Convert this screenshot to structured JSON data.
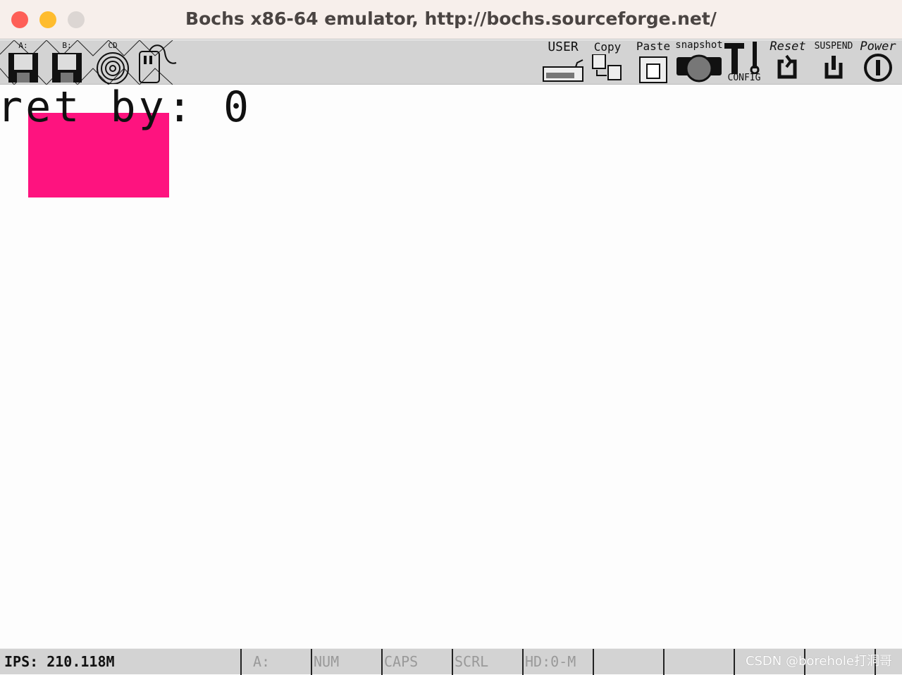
{
  "window": {
    "title": "Bochs x86-64 emulator, http://bochs.sourceforge.net/"
  },
  "toolbar": {
    "floppy_a": "A:",
    "floppy_b": "B:",
    "cdrom": "CD",
    "user": "USER",
    "copy": "Copy",
    "paste": "Paste",
    "snapshot": "snapshot",
    "config": "CONFIG",
    "reset": "Reset",
    "suspend": "SUSPEND",
    "power": "Power"
  },
  "screen": {
    "text": "ret by: 0",
    "rect_color": "#fe137f"
  },
  "statusbar": {
    "ips": "IPS: 210.118M",
    "cells": [
      "A:",
      "NUM",
      "CAPS",
      "SCRL",
      "HD:0-M",
      "",
      "",
      "",
      ""
    ],
    "watermark": "CSDN @borehole打洞哥"
  }
}
